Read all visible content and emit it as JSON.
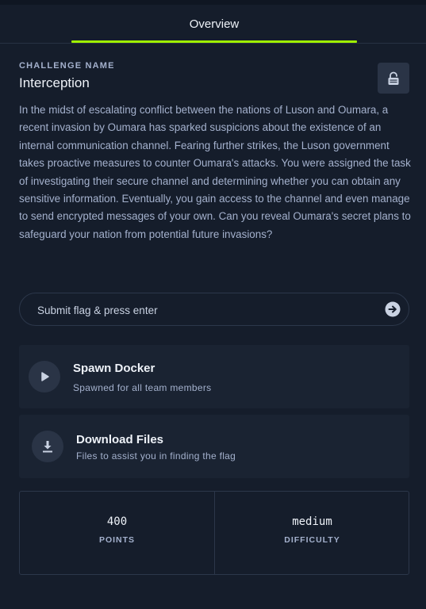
{
  "tabs": [
    {
      "label": "Overview",
      "active": true
    }
  ],
  "accent_color": "#9fef00",
  "challenge": {
    "label": "CHALLENGE NAME",
    "title": "Interception",
    "status_icon": "lock-icon",
    "description": "In the midst of escalating conflict between the nations of Luson and Oumara, a recent invasion by Oumara has sparked suspicions about the existence of an internal communication channel. Fearing further strikes, the Luson government takes proactive measures to counter Oumara's attacks. You were assigned the task of investigating their secure channel and determining whether you can obtain any sensitive information. Eventually, you gain access to the channel and even manage to send encrypted messages of your own. Can you reveal Oumara's secret plans to safeguard your nation from potential future invasions?"
  },
  "flag": {
    "placeholder": "Submit flag & press enter",
    "value": "",
    "submit_icon": "arrow-right-circle-icon"
  },
  "actions": {
    "spawn": {
      "title": "Spawn Docker",
      "subtitle": "Spawned for all team members",
      "icon": "play-icon"
    },
    "download": {
      "title": "Download Files",
      "subtitle": "Files to assist you in finding the flag",
      "icon": "download-icon"
    }
  },
  "stats": {
    "points": {
      "value": "400",
      "label": "POINTS"
    },
    "difficulty": {
      "value": "medium",
      "label": "DIFFICULTY"
    }
  }
}
